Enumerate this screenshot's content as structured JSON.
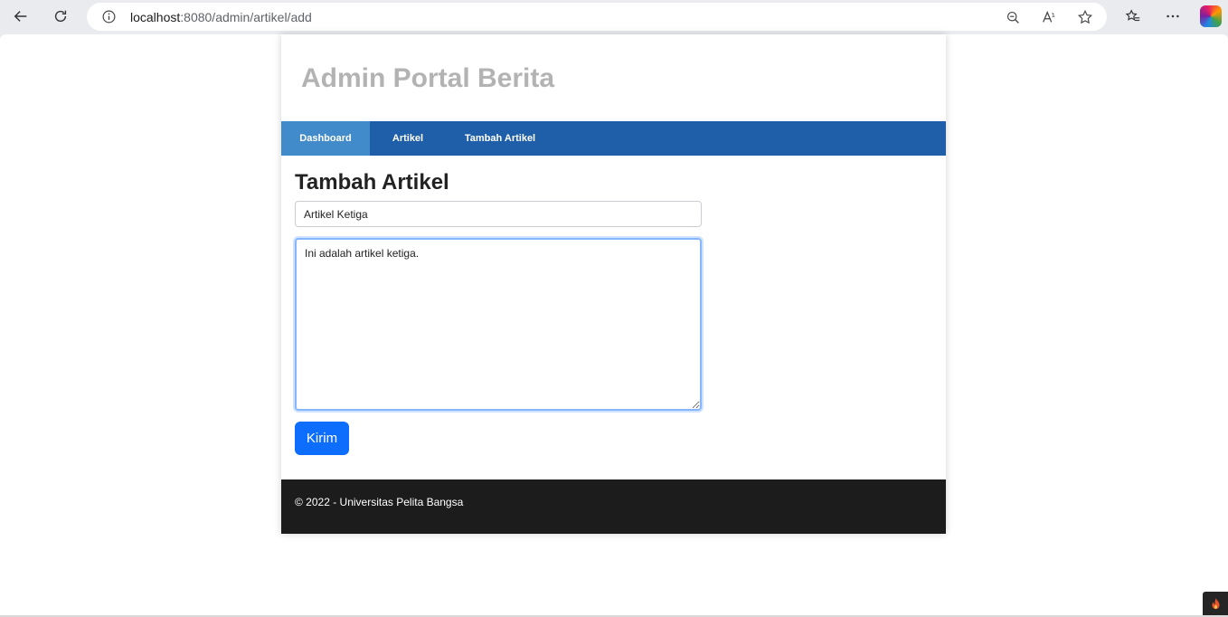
{
  "browser": {
    "url_host": "localhost",
    "url_rest": ":8080/admin/artikel/add",
    "icons": [
      "back-icon",
      "refresh-icon",
      "info-icon",
      "zoom-out-icon",
      "read-aloud-icon",
      "favorite-star-icon",
      "favorites-icon",
      "more-icon",
      "copilot-icon"
    ]
  },
  "page": {
    "site_title": "Admin Portal Berita",
    "nav": [
      {
        "label": "Dashboard",
        "active": true
      },
      {
        "label": "Artikel",
        "active": false
      },
      {
        "label": "Tambah Artikel",
        "active": false
      }
    ],
    "heading": "Tambah Artikel",
    "form": {
      "title_value": "Artikel Ketiga",
      "body_value": "Ini adalah artikel ketiga.",
      "submit_label": "Kirim"
    },
    "footer": "© 2022 - Universitas Pelita Bangsa"
  },
  "colors": {
    "nav_bg": "#1f5faa",
    "nav_active": "#428bca",
    "button": "#0d6efd",
    "footer_bg": "#1c1c1c",
    "title_color": "#b3b3b3"
  }
}
